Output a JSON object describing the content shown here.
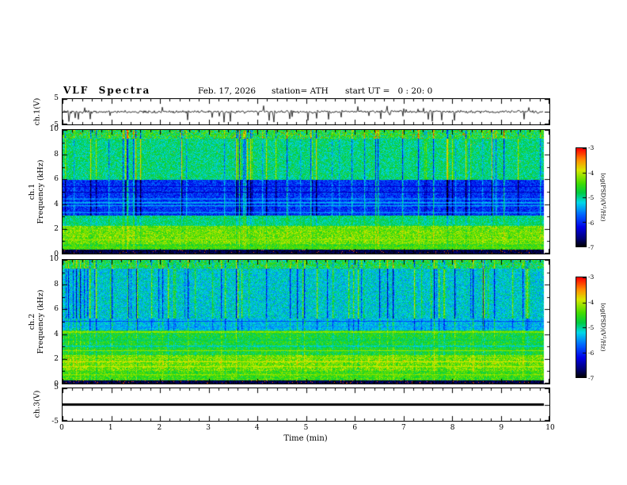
{
  "header": {
    "title": "VLF  Spectra",
    "date": "Feb. 17, 2026",
    "station": "station= ATH",
    "start_ut": "start UT =   0 : 20: 0"
  },
  "axes": {
    "x_label": "Time (min)",
    "ch1_wave_label": "ch.1(V)",
    "ch3_wave_label": "ch.3(V)",
    "spec1_label_lines": [
      "ch.1",
      "Frequency (kHz)"
    ],
    "spec2_label_lines": [
      "ch.2",
      "Frequency (kHz)"
    ],
    "colorbar_label": "log(PSD)(V²/Hz)"
  },
  "chart_data": {
    "type": "heatmap",
    "title": "VLF Spectra",
    "x_axis": {
      "label": "Time (min)",
      "range": [
        0,
        10
      ],
      "major_tick_labels": [
        "0",
        "1",
        "2",
        "3",
        "4",
        "5",
        "6",
        "7",
        "8",
        "9",
        "10"
      ],
      "minor_step_min": 0.2,
      "data_end_fraction": 0.988
    },
    "spec_y_axis": {
      "label": "Frequency (kHz)",
      "range": [
        0,
        10
      ],
      "labeled_ticks": [
        0,
        2,
        4,
        6,
        8,
        10
      ],
      "minor_ticks": [
        1,
        3,
        5,
        7,
        9
      ]
    },
    "wave_y_axis": {
      "range": [
        -5,
        5
      ],
      "labeled_ticks": [
        5,
        -5
      ],
      "tick_values": [
        5,
        0,
        -5
      ]
    },
    "colorbar": {
      "label": "log(PSD)(V²/Hz)",
      "range": [
        -7,
        -3
      ],
      "tick_labels": [
        "-3",
        "-4",
        "-5",
        "-6",
        "-7"
      ],
      "tick_values": [
        -3,
        -4,
        -5,
        -6,
        -7
      ],
      "colormap_stops": [
        [
          0.0,
          "#000000"
        ],
        [
          0.08,
          "#000070"
        ],
        [
          0.2,
          "#0000e8"
        ],
        [
          0.33,
          "#0068ff"
        ],
        [
          0.45,
          "#00d8e8"
        ],
        [
          0.55,
          "#00cc44"
        ],
        [
          0.65,
          "#44dd00"
        ],
        [
          0.78,
          "#d8e800"
        ],
        [
          0.88,
          "#ff9000"
        ],
        [
          1.0,
          "#ff0000"
        ]
      ]
    },
    "streaks": {
      "rate": 0.1,
      "pos_frac": 0.55,
      "min": 0.35,
      "max": 1.0,
      "decay": 0.3,
      "strength": 0.5
    },
    "panels": {
      "wave_ch1": {
        "kind": "waveform",
        "ylabel": "ch.1(V)",
        "ylim": [
          -5,
          5
        ],
        "noise_amp": 0.55,
        "neg_spike_rate": 0.05,
        "neg_spike_min": 1.2,
        "neg_spike_max": 3.8,
        "pos_spike_rate": 0.015,
        "pos_spike_max": 1.5
      },
      "spec_ch1": {
        "kind": "spectrogram",
        "ylabel": "ch.1 Frequency (kHz)",
        "ylim": [
          0,
          10
        ],
        "bands": [
          [
            0.0,
            0.33,
            0.05,
            0.05,
            0.05,
            0.03,
            0.93
          ],
          [
            0.33,
            0.8,
            0.62,
            0.1,
            0.15,
            0,
            0
          ],
          [
            0.8,
            2.25,
            0.68,
            0.11,
            0.18,
            0.002,
            0.88
          ],
          [
            2.25,
            3.1,
            0.52,
            0.08,
            0.25,
            0,
            0
          ],
          [
            3.1,
            6.0,
            0.26,
            0.09,
            0.6,
            0,
            0
          ],
          [
            6.0,
            9.35,
            0.52,
            0.1,
            -0.6,
            0.001,
            0.9
          ],
          [
            9.35,
            10.0,
            0.58,
            0.15,
            0.65,
            0.02,
            0.95
          ]
        ],
        "lines": [
          {
            "f": 0.55,
            "t": 0.7,
            "w": 0.08
          },
          {
            "f": 1.15,
            "t": 0.73,
            "w": 0.08
          },
          {
            "f": 1.6,
            "t": 0.7,
            "w": 0.06
          },
          {
            "f": 2.0,
            "t": 0.68,
            "w": 0.06
          },
          {
            "f": 3.35,
            "t": 0.46,
            "w": 0.07
          },
          {
            "f": 3.9,
            "t": 0.48,
            "w": 0.07
          },
          {
            "f": 4.15,
            "t": 0.5,
            "w": 0.09
          },
          {
            "f": 4.45,
            "t": 0.47,
            "w": 0.07
          },
          {
            "f": 5.0,
            "t": 0.12,
            "w": 0.06
          },
          {
            "f": 5.45,
            "t": 0.15,
            "w": 0.05
          }
        ]
      },
      "spec_ch2": {
        "kind": "spectrogram",
        "ylabel": "ch.2 Frequency (kHz)",
        "ylim": [
          0,
          10
        ],
        "bands": [
          [
            0.0,
            0.3,
            0.05,
            0.05,
            0.05,
            0.035,
            0.93
          ],
          [
            0.3,
            1.05,
            0.63,
            0.1,
            0.15,
            0,
            0
          ],
          [
            1.05,
            2.35,
            0.68,
            0.11,
            0.18,
            0.003,
            0.9
          ],
          [
            2.35,
            4.35,
            0.58,
            0.1,
            0.22,
            0,
            0
          ],
          [
            4.35,
            5.3,
            0.42,
            0.09,
            0.4,
            0,
            0
          ],
          [
            5.3,
            9.35,
            0.45,
            0.1,
            -0.62,
            0,
            0
          ],
          [
            9.35,
            10.0,
            0.56,
            0.13,
            0.5,
            0.012,
            0.92
          ]
        ],
        "lines": [
          {
            "f": 0.75,
            "t": 0.76,
            "w": 0.07
          },
          {
            "f": 1.4,
            "t": 0.79,
            "w": 0.08
          },
          {
            "f": 1.8,
            "t": 0.81,
            "w": 0.08
          },
          {
            "f": 2.15,
            "t": 0.73,
            "w": 0.06
          },
          {
            "f": 2.7,
            "t": 0.77,
            "w": 0.07
          },
          {
            "f": 3.05,
            "t": 0.32,
            "w": 0.06
          },
          {
            "f": 3.55,
            "t": 0.5,
            "w": 0.06
          },
          {
            "f": 4.2,
            "t": 0.81,
            "w": 0.09
          },
          {
            "f": 4.6,
            "t": 0.35,
            "w": 0.06
          },
          {
            "f": 5.05,
            "t": 0.2,
            "w": 0.05
          }
        ]
      },
      "wave_ch3": {
        "kind": "flatline",
        "ylabel": "ch.3(V)",
        "ylim": [
          -5,
          5
        ],
        "value": 0,
        "line_width": 3
      }
    }
  }
}
